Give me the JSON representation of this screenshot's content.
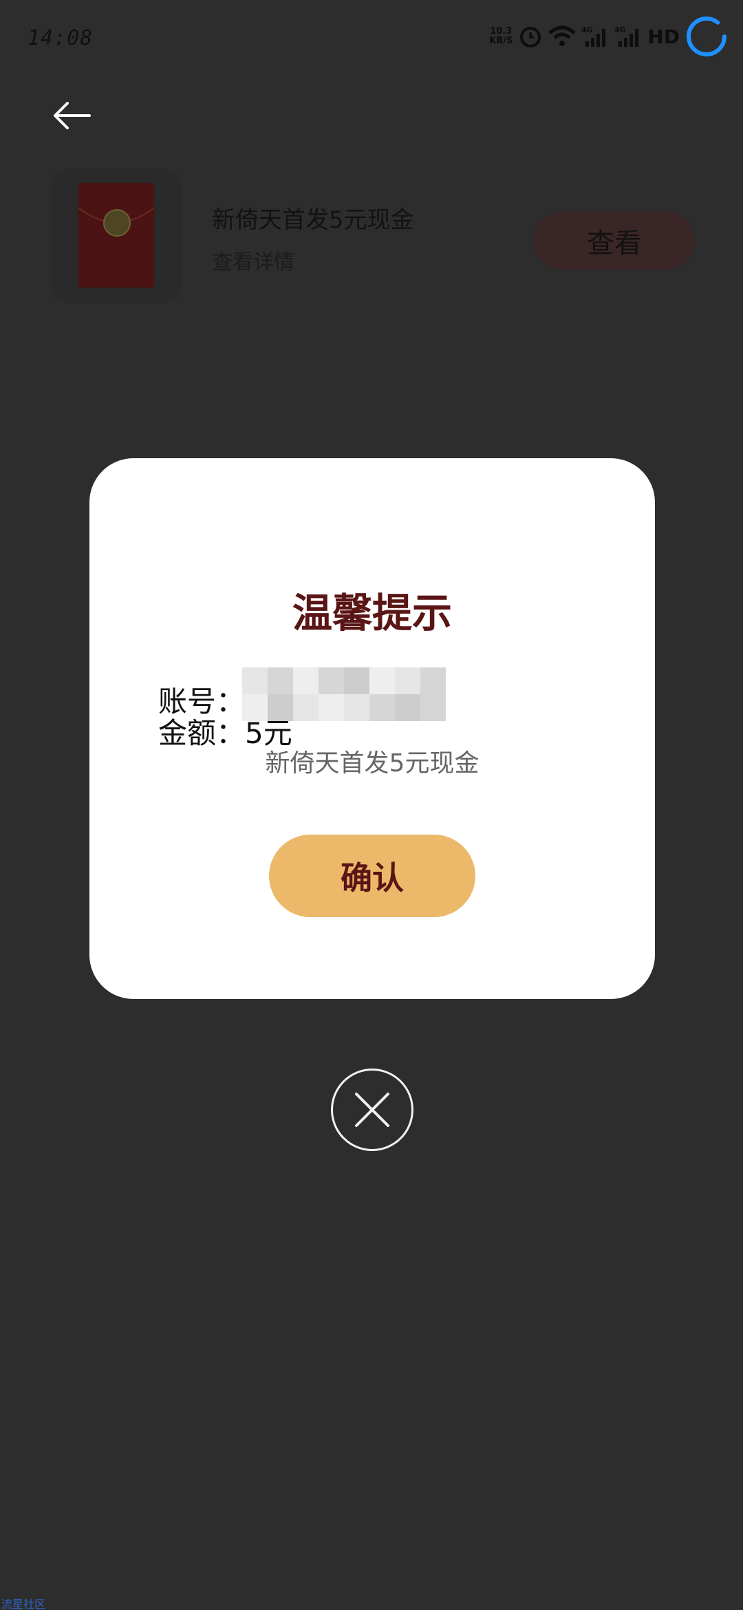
{
  "status_bar": {
    "time": "14:08",
    "net_speed_value": "10.3",
    "net_speed_unit": "KB/S",
    "hd_label": "HD",
    "icons": [
      "alarm-icon",
      "wifi-icon",
      "signal-4g-icon",
      "signal-4g-icon",
      "sync-icon"
    ],
    "accent_color": "#1e90ff"
  },
  "header": {
    "back_icon": "arrow-left-icon"
  },
  "reward_item": {
    "title": "新倚天首发5元现金",
    "subtitle": "查看详情",
    "view_button": "查看"
  },
  "dialog": {
    "title": "温馨提示",
    "account_label": "账号：",
    "account_value": "1",
    "amount_label": "金额：",
    "amount_value": "5元",
    "description": "新倚天首发5元现金",
    "confirm_button": "确认",
    "title_color": "#5a1515",
    "button_color": "#ecb86a"
  },
  "close_icon": "close-icon",
  "watermark": "流星社区"
}
